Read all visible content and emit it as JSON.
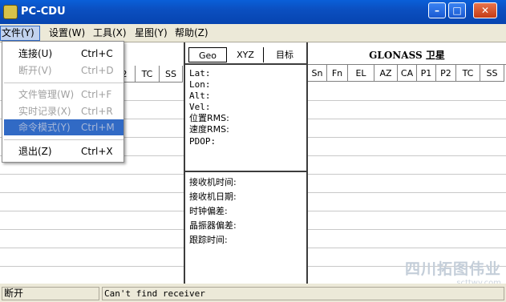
{
  "window": {
    "title": "PC-CDU",
    "min_glyph": "–",
    "max_glyph": "□",
    "close_glyph": "✕"
  },
  "menubar": {
    "file": "文件(Y)",
    "settings": "设置(W)",
    "tools": "工具(X)",
    "starmap": "星图(Y)",
    "help": "帮助(Z)"
  },
  "left_table": {
    "columns_visible": [
      "2",
      "TC",
      "SS"
    ]
  },
  "tabs": {
    "geo": "Geo",
    "xyz": "XYZ",
    "target": "目标"
  },
  "geo_fields": [
    "Lat:",
    "Lon:",
    "Alt:",
    "Vel:",
    "位置RMS:",
    "速度RMS:",
    "PDOP:"
  ],
  "receiver_fields": [
    "接收机时间:",
    "接收机日期:",
    "时钟偏差:",
    "晶振器偏差:",
    "跟踪时间:"
  ],
  "glonass": {
    "title": "GLONASS 卫星",
    "columns": [
      "Sn",
      "Fn",
      "EL",
      "AZ",
      "CA",
      "P1",
      "P2",
      "TC",
      "SS"
    ]
  },
  "file_menu": {
    "items": [
      {
        "label": "连接(U)",
        "shortcut": "Ctrl+C",
        "enabled": true
      },
      {
        "label": "断开(V)",
        "shortcut": "Ctrl+D",
        "enabled": false
      },
      {
        "label": "文件管理(W)",
        "shortcut": "Ctrl+F",
        "enabled": false
      },
      {
        "label": "实时记录(X)",
        "shortcut": "Ctrl+R",
        "enabled": false
      },
      {
        "label": "命令模式(Y)",
        "shortcut": "Ctrl+M",
        "enabled": false,
        "highlighted": true
      },
      {
        "label": "退出(Z)",
        "shortcut": "Ctrl+X",
        "enabled": true
      }
    ]
  },
  "statusbar": {
    "connection": "断开",
    "message": "Can't find receiver"
  },
  "watermark": {
    "text": "四川拓图伟业",
    "url": "scttwy.com"
  },
  "colors": {
    "titlebar": "#0b4fc0",
    "menu_highlight": "#316ac5",
    "window_bg": "#ece9d8"
  }
}
